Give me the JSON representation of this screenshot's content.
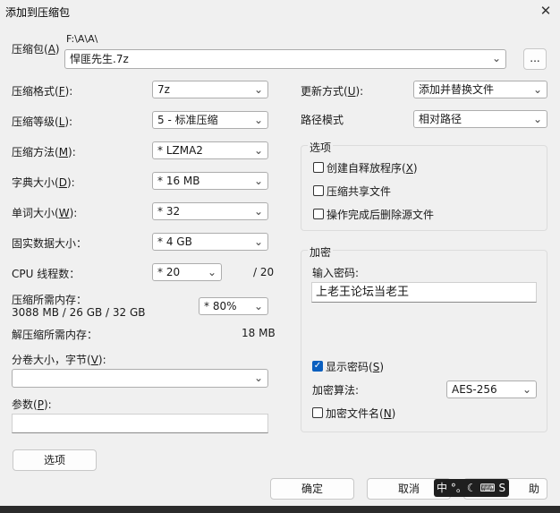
{
  "window": {
    "title": "添加到压缩包",
    "close_glyph": "✕"
  },
  "archive": {
    "label": "压缩包(A)",
    "label_prefix": "压缩包(",
    "label_key": "A",
    "label_suffix": ")",
    "path": "F:\\A\\A\\",
    "filename": "悍匪先生.7z",
    "browse_label": "..."
  },
  "left": {
    "format": {
      "label_a": "压缩格式(",
      "key": "F",
      "label_b": "):",
      "value": "7z"
    },
    "level": {
      "label_a": "压缩等级(",
      "key": "L",
      "label_b": "):",
      "value": "5 - 标准压缩"
    },
    "method": {
      "label_a": "压缩方法(",
      "key": "M",
      "label_b": "):",
      "value": "*  LZMA2"
    },
    "dict": {
      "label_a": "字典大小(",
      "key": "D",
      "label_b": "):",
      "value": "*  16 MB"
    },
    "word": {
      "label_a": "单词大小(",
      "key": "W",
      "label_b": "):",
      "value": "*  32"
    },
    "solid": {
      "label": "固实数据大小：",
      "value": "*  4 GB"
    },
    "cpu": {
      "label": "CPU 线程数：",
      "value": "*  20",
      "max": "/ 20"
    },
    "mem": {
      "label": "压缩所需内存：",
      "detail": "3088 MB / 26 GB / 32 GB",
      "value": "*  80%"
    },
    "decomp": {
      "label": "解压缩所需内存：",
      "value": "18 MB"
    },
    "volume": {
      "label_a": "分卷大小，字节(",
      "key": "V",
      "label_b": "):",
      "value": ""
    },
    "params": {
      "label_a": "参数(",
      "key": "P",
      "label_b": "):",
      "value": ""
    },
    "options_button": "选项"
  },
  "right": {
    "update": {
      "label_a": "更新方式(",
      "key": "U",
      "label_b": "):",
      "value": "添加并替换文件"
    },
    "path_mode": {
      "label": "路径模式",
      "value": "相对路径"
    },
    "options_group": {
      "title": "选项",
      "sfx": {
        "label_a": "创建自释放程序(",
        "key": "X",
        "label_b": ")",
        "checked": false
      },
      "shared": {
        "label": "压缩共享文件",
        "checked": false
      },
      "delete": {
        "label": "操作完成后删除源文件",
        "checked": false
      }
    },
    "encryption": {
      "title": "加密",
      "password_label": "输入密码:",
      "password_value": "上老王论坛当老王",
      "show_password": {
        "label_a": "显示密码(",
        "key": "S",
        "label_b": ")",
        "checked": true
      },
      "method_label": "加密算法:",
      "method_value": "AES-256",
      "encrypt_names": {
        "label_a": "加密文件名(",
        "key": "N",
        "label_b": ")",
        "checked": false
      }
    }
  },
  "buttons": {
    "ok": "确定",
    "cancel": "取消",
    "help_tail": "助"
  },
  "ime": {
    "text": "中 °。☾ ⌨ S"
  },
  "icons": {
    "chevron": "⌄",
    "check": "✓"
  }
}
